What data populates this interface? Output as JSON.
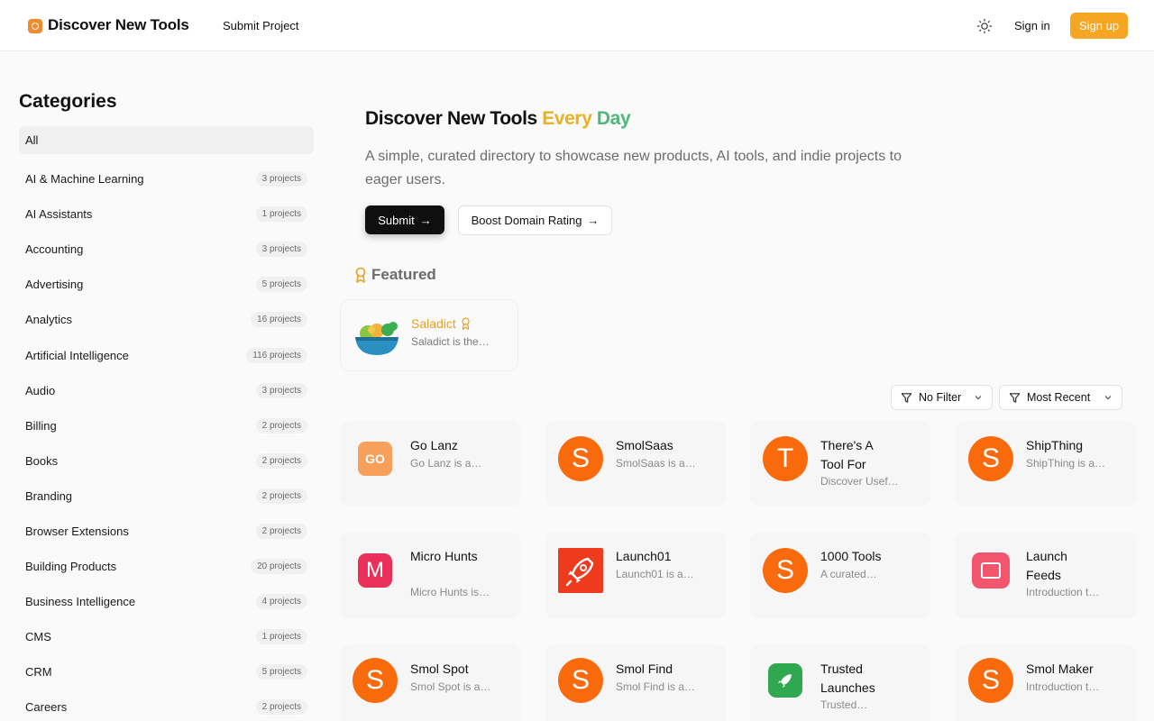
{
  "header": {
    "brand": "Discover New Tools",
    "nav_submit": "Submit Project",
    "signin": "Sign in",
    "signup": "Sign up"
  },
  "sidebar": {
    "title": "Categories",
    "items": [
      {
        "label": "All",
        "count": ""
      },
      {
        "label": "AI & Machine Learning",
        "count": "3 projects"
      },
      {
        "label": "AI Assistants",
        "count": "1 projects"
      },
      {
        "label": "Accounting",
        "count": "3 projects"
      },
      {
        "label": "Advertising",
        "count": "5 projects"
      },
      {
        "label": "Analytics",
        "count": "16 projects"
      },
      {
        "label": "Artificial Intelligence",
        "count": "116 projects"
      },
      {
        "label": "Audio",
        "count": "3 projects"
      },
      {
        "label": "Billing",
        "count": "2 projects"
      },
      {
        "label": "Books",
        "count": "2 projects"
      },
      {
        "label": "Branding",
        "count": "2 projects"
      },
      {
        "label": "Browser Extensions",
        "count": "2 projects"
      },
      {
        "label": "Building Products",
        "count": "20 projects"
      },
      {
        "label": "Business Intelligence",
        "count": "4 projects"
      },
      {
        "label": "CMS",
        "count": "1 projects"
      },
      {
        "label": "CRM",
        "count": "5 projects"
      },
      {
        "label": "Careers",
        "count": "2 projects"
      }
    ]
  },
  "hero": {
    "title_main": "Discover New Tools",
    "title_every": "Every",
    "title_day": "Day",
    "subtitle": "A simple, curated directory to showcase new products, AI tools, and indie projects to eager users.",
    "submit_label": "Submit",
    "boost_label": "Boost Domain Rating"
  },
  "featured": {
    "heading": "Featured",
    "card": {
      "name": "Saladict",
      "desc": "Saladict is the…"
    }
  },
  "filters": {
    "filter_label": "No Filter",
    "sort_label": "Most Recent"
  },
  "colors": {
    "accent": "#f6a623",
    "featured_name": "#e8a021",
    "orange_logo": "#f86a0c"
  },
  "projects": [
    {
      "name": "Go Lanz",
      "desc": "Go Lanz is a…",
      "logo": "GO",
      "icon": "go-lanz-logo-icon"
    },
    {
      "name": "SmolSaas",
      "desc": "SmolSaas is a…",
      "logo": "S",
      "icon": "smolsaas-logo-icon"
    },
    {
      "name": "There's A Tool For",
      "desc": "Discover Usef…",
      "logo": "T",
      "icon": "theres-a-tool-for-logo-icon"
    },
    {
      "name": "ShipThing",
      "desc": "ShipThing is a…",
      "logo": "S",
      "icon": "shipthing-logo-icon"
    },
    {
      "name": "Micro Hunts",
      "desc": "Micro Hunts is…",
      "logo": "M",
      "icon": "micro-hunts-logo-icon"
    },
    {
      "name": "Launch01",
      "desc": "Launch01 is a…",
      "logo": "",
      "icon": "rocket-icon"
    },
    {
      "name": "1000 Tools",
      "desc": "A curated…",
      "logo": "S",
      "icon": "1000-tools-logo-icon"
    },
    {
      "name": "Launch Feeds",
      "desc": "Introduction t…",
      "logo": "",
      "icon": "launch-feeds-logo-icon"
    },
    {
      "name": "Smol Spot",
      "desc": "Smol Spot is a…",
      "logo": "S",
      "icon": "smol-spot-logo-icon"
    },
    {
      "name": "Smol Find",
      "desc": "Smol Find is a…",
      "logo": "S",
      "icon": "smol-find-logo-icon"
    },
    {
      "name": "Trusted Launches",
      "desc": "Trusted…",
      "logo": "",
      "icon": "trusted-launches-logo-icon"
    },
    {
      "name": "Smol Maker",
      "desc": "Introduction t…",
      "logo": "S",
      "icon": "smol-maker-logo-icon"
    }
  ]
}
